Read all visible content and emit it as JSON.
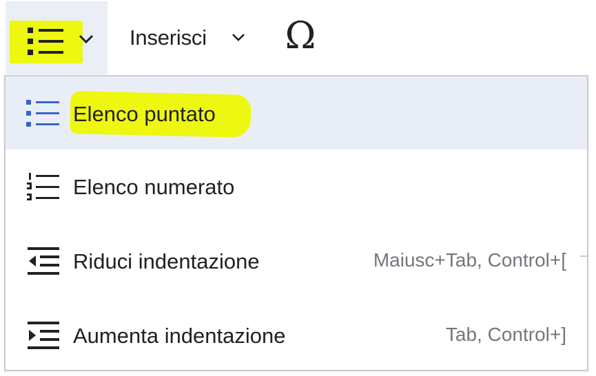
{
  "toolbar": {
    "list_button": {
      "icon": "bullet-list-icon",
      "caret": "chevron-down-icon"
    },
    "insert_button": {
      "label": "Inserisci",
      "caret": "chevron-down-icon"
    },
    "special_chars_button": {
      "glyph": "Ω"
    }
  },
  "menu": {
    "items": [
      {
        "label": "Elenco puntato",
        "icon": "bullet-list-icon",
        "shortcut": "",
        "selected": true
      },
      {
        "label": "Elenco numerato",
        "icon": "numbered-list-icon",
        "shortcut": ""
      },
      {
        "label": "Riduci indentazione",
        "icon": "outdent-icon",
        "shortcut": "Maiusc+Tab, Control+["
      },
      {
        "label": "Aumenta indentazione",
        "icon": "indent-icon",
        "shortcut": "Tab, Control+]"
      }
    ]
  },
  "colors": {
    "highlight": "#eef70f",
    "icon_blue": "#36c",
    "text": "#202122",
    "shortcut_text": "#72777d",
    "selected_bg": "#e9edf5",
    "border": "#c8ccd1"
  }
}
